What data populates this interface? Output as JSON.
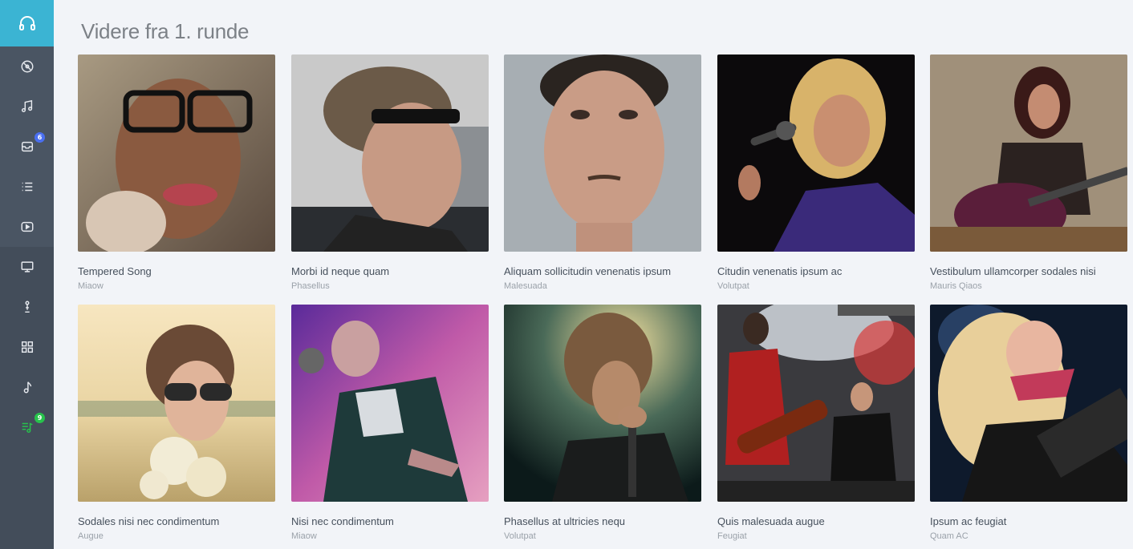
{
  "sidebar": {
    "top_icon": "headphones-icon",
    "items": [
      {
        "icon": "disc-icon"
      },
      {
        "icon": "music-note-icon"
      },
      {
        "icon": "inbox-icon",
        "badge": "6",
        "badge_color": "#4a6ff0"
      },
      {
        "icon": "list-icon"
      },
      {
        "icon": "play-video-icon"
      },
      {
        "icon": "monitor-icon"
      },
      {
        "icon": "microphone-icon"
      },
      {
        "icon": "grid-icon"
      },
      {
        "icon": "single-note-icon"
      },
      {
        "icon": "playlist-icon",
        "badge": "9",
        "badge_color": "#27c24c"
      }
    ]
  },
  "page_title": "Videre fra 1. runde",
  "cards": [
    {
      "title": "Tempered Song",
      "subtitle": "Miaow"
    },
    {
      "title": "Morbi id neque quam",
      "subtitle": "Phasellus"
    },
    {
      "title": "Aliquam sollicitudin venenatis ipsum",
      "subtitle": "Malesuada"
    },
    {
      "title": "Citudin venenatis ipsum ac",
      "subtitle": "Volutpat"
    },
    {
      "title": "Vestibulum ullamcorper sodales nisi",
      "subtitle": "Mauris Qiaos"
    },
    {
      "title": "Sodales nisi nec condimentum",
      "subtitle": "Augue"
    },
    {
      "title": "Nisi nec condimentum",
      "subtitle": "Miaow"
    },
    {
      "title": "Phasellus at ultricies nequ",
      "subtitle": "Volutpat"
    },
    {
      "title": "Quis malesuada augue",
      "subtitle": "Feugiat"
    },
    {
      "title": "Ipsum ac feugiat",
      "subtitle": "Quam AC"
    }
  ],
  "colors": {
    "sidebar": "#4a5563",
    "accent": "#3bb4d3",
    "badge_blue": "#4a6ff0",
    "badge_green": "#27c24c"
  }
}
